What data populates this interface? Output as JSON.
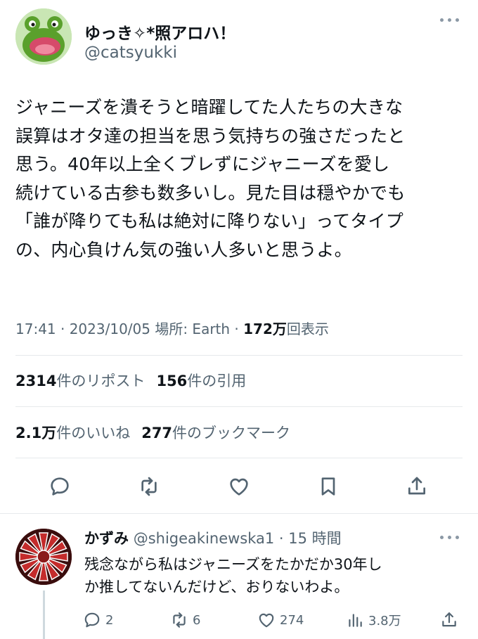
{
  "tweet": {
    "author_name": "ゆっき✧*照アロハ！",
    "author_handle": "@catsyukki",
    "text": "ジャニーズを潰そうと暗躍してた人たちの大きな\n誤算はオタ達の担当を思う気持ちの強さだったと\n思う。40年以上全くブレずにジャニーズを愛し\n続けている古参も数多いし。見た目は穏やかでも\n「誰が降りても私は絶対に降りない」ってタイプ\nの、内心負けん気の強い人多いと思うよ。",
    "time": "17:41 · 2023/10/05 場所: Earth · ",
    "views_count": "172万",
    "views_label": "回表示"
  },
  "stats": {
    "reposts_count": "2314",
    "reposts_label": "件のリポスト",
    "quotes_count": "156",
    "quotes_label": "件の引用",
    "likes_count": "2.1万",
    "likes_label": "件のいいね",
    "bookmarks_count": "277",
    "bookmarks_label": "件のブックマーク"
  },
  "actions": {
    "icons": [
      "reply-icon",
      "repost-icon",
      "like-icon",
      "bookmark-icon",
      "share-icon"
    ]
  },
  "reply": {
    "name": "かずみ",
    "handle": "@shigeakinewska1 · 15 時間",
    "text": "残念ながら私はジャニーズをたかだか30年し\nか推してないんだけど、おりないわよ。",
    "replies": "2",
    "reposts": "6",
    "likes": "274",
    "views": "3.8万"
  },
  "colors": {
    "text": "#0f1419",
    "secondary": "#536471",
    "divider": "#e6e9ec",
    "icon": "#536471"
  }
}
